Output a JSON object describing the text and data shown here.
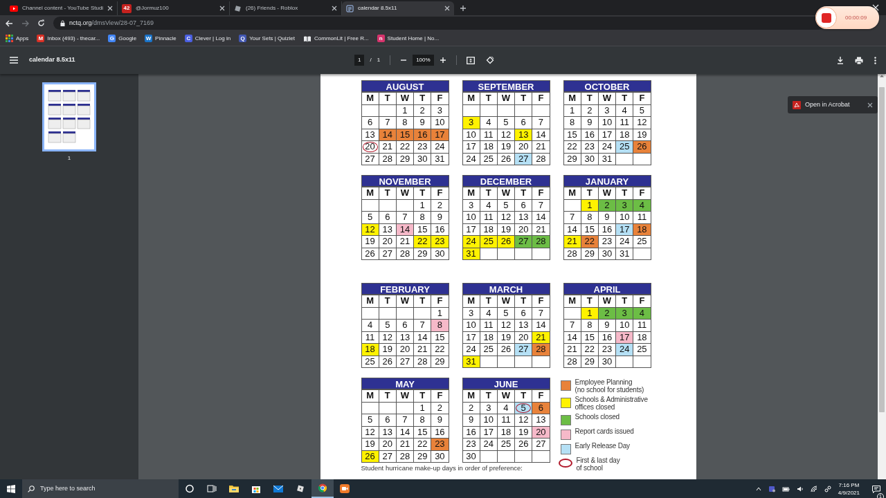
{
  "browser": {
    "tabs": [
      {
        "title": "Channel content - YouTube Studi",
        "selected": false
      },
      {
        "title": "@Jormuz100",
        "badge": "42",
        "selected": false
      },
      {
        "title": "(26) Friends - Roblox",
        "selected": false
      },
      {
        "title": "calendar 8.5x11",
        "selected": true
      }
    ],
    "url": "**nctq.org**/dmsView/28-07_7169",
    "bookmarks": [
      {
        "label": "Apps"
      },
      {
        "label": "Inbox (493) - thecar...",
        "letter": "M",
        "color": "#d93025"
      },
      {
        "label": "Google",
        "letter": "G",
        "color": "#4285f4"
      },
      {
        "label": "Pinnacle",
        "letter": "W",
        "color": "#1a73c8"
      },
      {
        "label": "Clever | Log in",
        "letter": "C",
        "color": "#4a5fe0"
      },
      {
        "label": "Your Sets | Quizlet",
        "letter": "Q",
        "color": "#4257b2"
      },
      {
        "label": "CommonLit | Free R..."
      },
      {
        "label": "Student Home | No...",
        "letter": "n",
        "color": "#d6336c"
      }
    ]
  },
  "viewer": {
    "title": "calendar 8.5x11",
    "page": "1",
    "page_sep": "/",
    "page_total": "1",
    "zoom": "100%",
    "thumbnail_label": "1"
  },
  "calendar": {
    "months": [
      {
        "name": "AUGUST",
        "weekdays": [
          "M",
          "T",
          "W",
          "T",
          "F"
        ],
        "weeks": [
          [
            {
              "kind": "blank"
            },
            {
              "kind": "blank"
            },
            {
              "day": "1",
              "kind": "plain"
            },
            {
              "day": "2",
              "kind": "plain"
            },
            {
              "day": "3",
              "kind": "plain"
            }
          ],
          [
            {
              "day": "6",
              "kind": "plain"
            },
            {
              "day": "7",
              "kind": "plain"
            },
            {
              "day": "8",
              "kind": "plain"
            },
            {
              "day": "9",
              "kind": "plain"
            },
            {
              "day": "10",
              "kind": "plain"
            }
          ],
          [
            {
              "day": "13",
              "kind": "plain"
            },
            {
              "day": "14",
              "kind": "planning"
            },
            {
              "day": "15",
              "kind": "planning"
            },
            {
              "day": "16",
              "kind": "planning"
            },
            {
              "day": "17",
              "kind": "planning"
            }
          ],
          [
            {
              "day": "20",
              "kind": "plain",
              "circled": true
            },
            {
              "day": "21",
              "kind": "plain"
            },
            {
              "day": "22",
              "kind": "plain"
            },
            {
              "day": "23",
              "kind": "plain"
            },
            {
              "day": "24",
              "kind": "plain"
            }
          ],
          [
            {
              "day": "27",
              "kind": "plain"
            },
            {
              "day": "28",
              "kind": "plain"
            },
            {
              "day": "29",
              "kind": "plain"
            },
            {
              "day": "30",
              "kind": "plain"
            },
            {
              "day": "31",
              "kind": "plain"
            }
          ]
        ]
      },
      {
        "name": "SEPTEMBER",
        "weekdays": [
          "M",
          "T",
          "W",
          "T",
          "F"
        ],
        "weeks": [
          [
            {
              "kind": "blank"
            },
            {
              "kind": "blank"
            },
            {
              "kind": "blank"
            },
            {
              "kind": "blank"
            },
            {
              "kind": "blank"
            }
          ],
          [
            {
              "day": "3",
              "kind": "admin"
            },
            {
              "day": "4",
              "kind": "plain"
            },
            {
              "day": "5",
              "kind": "plain"
            },
            {
              "day": "6",
              "kind": "plain"
            },
            {
              "day": "7",
              "kind": "plain"
            }
          ],
          [
            {
              "day": "10",
              "kind": "plain"
            },
            {
              "day": "11",
              "kind": "plain"
            },
            {
              "day": "12",
              "kind": "plain"
            },
            {
              "day": "13",
              "kind": "admin"
            },
            {
              "day": "14",
              "kind": "plain"
            }
          ],
          [
            {
              "day": "17",
              "kind": "plain"
            },
            {
              "day": "18",
              "kind": "plain"
            },
            {
              "day": "19",
              "kind": "plain"
            },
            {
              "day": "20",
              "kind": "plain"
            },
            {
              "day": "21",
              "kind": "plain"
            }
          ],
          [
            {
              "day": "24",
              "kind": "plain"
            },
            {
              "day": "25",
              "kind": "plain"
            },
            {
              "day": "26",
              "kind": "plain"
            },
            {
              "day": "27",
              "kind": "early"
            },
            {
              "day": "28",
              "kind": "plain"
            }
          ]
        ]
      },
      {
        "name": "OCTOBER",
        "weekdays": [
          "M",
          "T",
          "W",
          "T",
          "F"
        ],
        "weeks": [
          [
            {
              "day": "1",
              "kind": "plain"
            },
            {
              "day": "2",
              "kind": "plain"
            },
            {
              "day": "3",
              "kind": "plain"
            },
            {
              "day": "4",
              "kind": "plain"
            },
            {
              "day": "5",
              "kind": "plain"
            }
          ],
          [
            {
              "day": "8",
              "kind": "plain"
            },
            {
              "day": "9",
              "kind": "plain"
            },
            {
              "day": "10",
              "kind": "plain"
            },
            {
              "day": "11",
              "kind": "plain"
            },
            {
              "day": "12",
              "kind": "plain"
            }
          ],
          [
            {
              "day": "15",
              "kind": "plain"
            },
            {
              "day": "16",
              "kind": "plain"
            },
            {
              "day": "17",
              "kind": "plain"
            },
            {
              "day": "18",
              "kind": "plain"
            },
            {
              "day": "19",
              "kind": "plain"
            }
          ],
          [
            {
              "day": "22",
              "kind": "plain"
            },
            {
              "day": "23",
              "kind": "plain"
            },
            {
              "day": "24",
              "kind": "plain"
            },
            {
              "day": "25",
              "kind": "early"
            },
            {
              "day": "26",
              "kind": "planning"
            }
          ],
          [
            {
              "day": "29",
              "kind": "plain"
            },
            {
              "day": "30",
              "kind": "plain"
            },
            {
              "day": "31",
              "kind": "plain"
            },
            {
              "kind": "blank"
            },
            {
              "kind": "blank"
            }
          ]
        ]
      },
      {
        "name": "NOVEMBER",
        "weekdays": [
          "M",
          "T",
          "W",
          "T",
          "F"
        ],
        "weeks": [
          [
            {
              "kind": "blank"
            },
            {
              "kind": "blank"
            },
            {
              "kind": "blank"
            },
            {
              "day": "1",
              "kind": "plain"
            },
            {
              "day": "2",
              "kind": "plain"
            }
          ],
          [
            {
              "day": "5",
              "kind": "plain"
            },
            {
              "day": "6",
              "kind": "plain"
            },
            {
              "day": "7",
              "kind": "plain"
            },
            {
              "day": "8",
              "kind": "plain"
            },
            {
              "day": "9",
              "kind": "plain"
            }
          ],
          [
            {
              "day": "12",
              "kind": "admin"
            },
            {
              "day": "13",
              "kind": "plain"
            },
            {
              "day": "14",
              "kind": "report"
            },
            {
              "day": "15",
              "kind": "plain"
            },
            {
              "day": "16",
              "kind": "plain"
            }
          ],
          [
            {
              "day": "19",
              "kind": "plain"
            },
            {
              "day": "20",
              "kind": "plain"
            },
            {
              "day": "21",
              "kind": "plain"
            },
            {
              "day": "22",
              "kind": "admin"
            },
            {
              "day": "23",
              "kind": "admin"
            }
          ],
          [
            {
              "day": "26",
              "kind": "plain"
            },
            {
              "day": "27",
              "kind": "plain"
            },
            {
              "day": "28",
              "kind": "plain"
            },
            {
              "day": "29",
              "kind": "plain"
            },
            {
              "day": "30",
              "kind": "plain"
            }
          ]
        ]
      },
      {
        "name": "DECEMBER",
        "weekdays": [
          "M",
          "T",
          "W",
          "T",
          "F"
        ],
        "weeks": [
          [
            {
              "day": "3",
              "kind": "plain"
            },
            {
              "day": "4",
              "kind": "plain"
            },
            {
              "day": "5",
              "kind": "plain"
            },
            {
              "day": "6",
              "kind": "plain"
            },
            {
              "day": "7",
              "kind": "plain"
            }
          ],
          [
            {
              "day": "10",
              "kind": "plain"
            },
            {
              "day": "11",
              "kind": "plain"
            },
            {
              "day": "12",
              "kind": "plain"
            },
            {
              "day": "13",
              "kind": "plain"
            },
            {
              "day": "14",
              "kind": "plain"
            }
          ],
          [
            {
              "day": "17",
              "kind": "plain"
            },
            {
              "day": "18",
              "kind": "plain"
            },
            {
              "day": "19",
              "kind": "plain"
            },
            {
              "day": "20",
              "kind": "plain"
            },
            {
              "day": "21",
              "kind": "plain"
            }
          ],
          [
            {
              "day": "24",
              "kind": "admin"
            },
            {
              "day": "25",
              "kind": "admin"
            },
            {
              "day": "26",
              "kind": "admin"
            },
            {
              "day": "27",
              "kind": "closed"
            },
            {
              "day": "28",
              "kind": "closed"
            }
          ],
          [
            {
              "day": "31",
              "kind": "admin"
            },
            {
              "kind": "blank"
            },
            {
              "kind": "blank"
            },
            {
              "kind": "blank"
            },
            {
              "kind": "blank"
            }
          ]
        ]
      },
      {
        "name": "JANUARY",
        "weekdays": [
          "M",
          "T",
          "W",
          "T",
          "F"
        ],
        "weeks": [
          [
            {
              "kind": "blank"
            },
            {
              "day": "1",
              "kind": "admin"
            },
            {
              "day": "2",
              "kind": "closed"
            },
            {
              "day": "3",
              "kind": "closed"
            },
            {
              "day": "4",
              "kind": "closed"
            }
          ],
          [
            {
              "day": "7",
              "kind": "plain"
            },
            {
              "day": "8",
              "kind": "plain"
            },
            {
              "day": "9",
              "kind": "plain"
            },
            {
              "day": "10",
              "kind": "plain"
            },
            {
              "day": "11",
              "kind": "plain"
            }
          ],
          [
            {
              "day": "14",
              "kind": "plain"
            },
            {
              "day": "15",
              "kind": "plain"
            },
            {
              "day": "16",
              "kind": "plain"
            },
            {
              "day": "17",
              "kind": "early"
            },
            {
              "day": "18",
              "kind": "planning"
            }
          ],
          [
            {
              "day": "21",
              "kind": "admin"
            },
            {
              "day": "22",
              "kind": "planning"
            },
            {
              "day": "23",
              "kind": "plain"
            },
            {
              "day": "24",
              "kind": "plain"
            },
            {
              "day": "25",
              "kind": "plain"
            }
          ],
          [
            {
              "day": "28",
              "kind": "plain"
            },
            {
              "day": "29",
              "kind": "plain"
            },
            {
              "day": "30",
              "kind": "plain"
            },
            {
              "day": "31",
              "kind": "plain"
            },
            {
              "kind": "blank"
            }
          ]
        ]
      },
      {
        "name": "FEBRUARY",
        "weekdays": [
          "M",
          "T",
          "W",
          "T",
          "F"
        ],
        "weeks": [
          [
            {
              "kind": "blank"
            },
            {
              "kind": "blank"
            },
            {
              "kind": "blank"
            },
            {
              "kind": "blank"
            },
            {
              "day": "1",
              "kind": "plain"
            }
          ],
          [
            {
              "day": "4",
              "kind": "plain"
            },
            {
              "day": "5",
              "kind": "plain"
            },
            {
              "day": "6",
              "kind": "plain"
            },
            {
              "day": "7",
              "kind": "plain"
            },
            {
              "day": "8",
              "kind": "report"
            }
          ],
          [
            {
              "day": "11",
              "kind": "plain"
            },
            {
              "day": "12",
              "kind": "plain"
            },
            {
              "day": "13",
              "kind": "plain"
            },
            {
              "day": "14",
              "kind": "plain"
            },
            {
              "day": "15",
              "kind": "plain"
            }
          ],
          [
            {
              "day": "18",
              "kind": "admin"
            },
            {
              "day": "19",
              "kind": "plain"
            },
            {
              "day": "20",
              "kind": "plain"
            },
            {
              "day": "21",
              "kind": "plain"
            },
            {
              "day": "22",
              "kind": "plain"
            }
          ],
          [
            {
              "day": "25",
              "kind": "plain"
            },
            {
              "day": "26",
              "kind": "plain"
            },
            {
              "day": "27",
              "kind": "plain"
            },
            {
              "day": "28",
              "kind": "plain"
            },
            {
              "day": "29",
              "kind": "plain"
            }
          ]
        ]
      },
      {
        "name": "MARCH",
        "weekdays": [
          "M",
          "T",
          "W",
          "T",
          "F"
        ],
        "weeks": [
          [
            {
              "day": "3",
              "kind": "plain"
            },
            {
              "day": "4",
              "kind": "plain"
            },
            {
              "day": "5",
              "kind": "plain"
            },
            {
              "day": "6",
              "kind": "plain"
            },
            {
              "day": "7",
              "kind": "plain"
            }
          ],
          [
            {
              "day": "10",
              "kind": "plain"
            },
            {
              "day": "11",
              "kind": "plain"
            },
            {
              "day": "12",
              "kind": "plain"
            },
            {
              "day": "13",
              "kind": "plain"
            },
            {
              "day": "14",
              "kind": "plain"
            }
          ],
          [
            {
              "day": "17",
              "kind": "plain"
            },
            {
              "day": "18",
              "kind": "plain"
            },
            {
              "day": "19",
              "kind": "plain"
            },
            {
              "day": "20",
              "kind": "plain"
            },
            {
              "day": "21",
              "kind": "admin"
            }
          ],
          [
            {
              "day": "24",
              "kind": "plain"
            },
            {
              "day": "25",
              "kind": "plain"
            },
            {
              "day": "26",
              "kind": "plain"
            },
            {
              "day": "27",
              "kind": "early"
            },
            {
              "day": "28",
              "kind": "planning"
            }
          ],
          [
            {
              "day": "31",
              "kind": "admin"
            },
            {
              "kind": "blank"
            },
            {
              "kind": "blank"
            },
            {
              "kind": "blank"
            },
            {
              "kind": "blank"
            }
          ]
        ]
      },
      {
        "name": "APRIL",
        "weekdays": [
          "M",
          "T",
          "W",
          "T",
          "F"
        ],
        "weeks": [
          [
            {
              "kind": "blank"
            },
            {
              "day": "1",
              "kind": "admin"
            },
            {
              "day": "2",
              "kind": "closed"
            },
            {
              "day": "3",
              "kind": "closed"
            },
            {
              "day": "4",
              "kind": "closed"
            }
          ],
          [
            {
              "day": "7",
              "kind": "plain"
            },
            {
              "day": "8",
              "kind": "plain"
            },
            {
              "day": "9",
              "kind": "plain"
            },
            {
              "day": "10",
              "kind": "plain"
            },
            {
              "day": "11",
              "kind": "plain"
            }
          ],
          [
            {
              "day": "14",
              "kind": "plain"
            },
            {
              "day": "15",
              "kind": "plain"
            },
            {
              "day": "16",
              "kind": "plain"
            },
            {
              "day": "17",
              "kind": "report"
            },
            {
              "day": "18",
              "kind": "plain"
            }
          ],
          [
            {
              "day": "21",
              "kind": "plain"
            },
            {
              "day": "22",
              "kind": "plain"
            },
            {
              "day": "23",
              "kind": "plain"
            },
            {
              "day": "24",
              "kind": "early"
            },
            {
              "day": "25",
              "kind": "plain"
            }
          ],
          [
            {
              "day": "28",
              "kind": "plain"
            },
            {
              "day": "29",
              "kind": "plain"
            },
            {
              "day": "30",
              "kind": "plain"
            },
            {
              "kind": "blank"
            },
            {
              "kind": "blank"
            }
          ]
        ]
      },
      {
        "name": "MAY",
        "weekdays": [
          "M",
          "T",
          "W",
          "T",
          "F"
        ],
        "weeks": [
          [
            {
              "kind": "blank"
            },
            {
              "kind": "blank"
            },
            {
              "kind": "blank"
            },
            {
              "day": "1",
              "kind": "plain"
            },
            {
              "day": "2",
              "kind": "plain"
            }
          ],
          [
            {
              "day": "5",
              "kind": "plain"
            },
            {
              "day": "6",
              "kind": "plain"
            },
            {
              "day": "7",
              "kind": "plain"
            },
            {
              "day": "8",
              "kind": "plain"
            },
            {
              "day": "9",
              "kind": "plain"
            }
          ],
          [
            {
              "day": "12",
              "kind": "plain"
            },
            {
              "day": "13",
              "kind": "plain"
            },
            {
              "day": "14",
              "kind": "plain"
            },
            {
              "day": "15",
              "kind": "plain"
            },
            {
              "day": "16",
              "kind": "plain"
            }
          ],
          [
            {
              "day": "19",
              "kind": "plain"
            },
            {
              "day": "20",
              "kind": "plain"
            },
            {
              "day": "21",
              "kind": "plain"
            },
            {
              "day": "22",
              "kind": "plain"
            },
            {
              "day": "23",
              "kind": "planning"
            }
          ],
          [
            {
              "day": "26",
              "kind": "admin"
            },
            {
              "day": "27",
              "kind": "plain"
            },
            {
              "day": "28",
              "kind": "plain"
            },
            {
              "day": "29",
              "kind": "plain"
            },
            {
              "day": "30",
              "kind": "plain"
            }
          ]
        ]
      },
      {
        "name": "JUNE",
        "weekdays": [
          "M",
          "T",
          "W",
          "T",
          "F"
        ],
        "weeks": [
          [
            {
              "day": "2",
              "kind": "plain"
            },
            {
              "day": "3",
              "kind": "plain"
            },
            {
              "day": "4",
              "kind": "plain"
            },
            {
              "day": "5",
              "kind": "early",
              "circled": true
            },
            {
              "day": "6",
              "kind": "planning"
            }
          ],
          [
            {
              "day": "9",
              "kind": "plain"
            },
            {
              "day": "10",
              "kind": "plain"
            },
            {
              "day": "11",
              "kind": "plain"
            },
            {
              "day": "12",
              "kind": "plain"
            },
            {
              "day": "13",
              "kind": "plain"
            }
          ],
          [
            {
              "day": "16",
              "kind": "plain"
            },
            {
              "day": "17",
              "kind": "plain"
            },
            {
              "day": "18",
              "kind": "plain"
            },
            {
              "day": "19",
              "kind": "plain"
            },
            {
              "day": "20",
              "kind": "report"
            }
          ],
          [
            {
              "day": "23",
              "kind": "plain"
            },
            {
              "day": "24",
              "kind": "plain"
            },
            {
              "day": "25",
              "kind": "plain"
            },
            {
              "day": "26",
              "kind": "plain"
            },
            {
              "day": "27",
              "kind": "plain"
            }
          ],
          [
            {
              "day": "30",
              "kind": "plain"
            },
            {
              "kind": "blank"
            },
            {
              "kind": "blank"
            },
            {
              "kind": "blank"
            },
            {
              "kind": "blank"
            }
          ]
        ]
      }
    ],
    "legend": [
      {
        "kind": "planning",
        "color": "#e8823a",
        "label": "Employee Planning\n(no school for students)"
      },
      {
        "kind": "admin",
        "color": "#fff200",
        "label": "Schools & Administrative\noffices closed"
      },
      {
        "kind": "closed",
        "color": "#6cbd45",
        "label": "Schools closed"
      },
      {
        "kind": "report",
        "color": "#f6b9c9",
        "label": "Report cards issued"
      },
      {
        "kind": "early",
        "color": "#b5e0f5",
        "label": "Early Release Day"
      },
      {
        "kind": "circle",
        "color": "#b0182a",
        "label": "First & last day\nof school"
      }
    ],
    "footnote": "Student hurricane make-up days in order of preference:"
  },
  "toast": {
    "label": "Open in Acrobat"
  },
  "recorder": {
    "time": "00:00:09"
  },
  "taskbar": {
    "search_placeholder": "Type here to search",
    "time": "7:16 PM",
    "date": "4/9/2021",
    "notifications": "1"
  }
}
